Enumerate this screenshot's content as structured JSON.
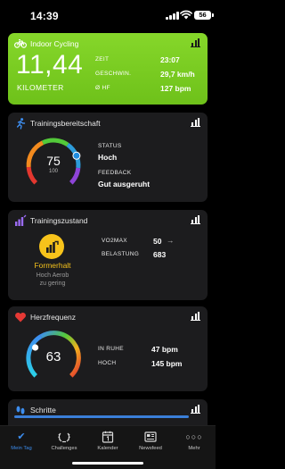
{
  "status_bar": {
    "time": "14:39",
    "battery": "56"
  },
  "cycling": {
    "title": "Indoor Cycling",
    "value": "11,44",
    "unit": "KILOMETER",
    "stats": [
      {
        "label": "ZEIT",
        "value": "23:07"
      },
      {
        "label": "GESCHWIN.",
        "value": "29,7 km/h"
      },
      {
        "label": "Ø HF",
        "value": "127 bpm"
      }
    ]
  },
  "readiness": {
    "title": "Trainingsbereitschaft",
    "score": "75",
    "max": "100",
    "level": 0.75,
    "status_label": "STATUS",
    "status_value": "Hoch",
    "feedback_label": "FEEDBACK",
    "feedback_value": "Gut ausgeruht"
  },
  "training_status": {
    "title": "Trainingszustand",
    "status": "Formerhalt",
    "sub_line1": "Hoch Aerob",
    "sub_line2": "zu gering",
    "vo2_label": "VO2MAX",
    "vo2_value": "50",
    "vo2_trend": "→",
    "load_label": "BELASTUNG",
    "load_value": "683"
  },
  "heart_rate": {
    "title": "Herzfrequenz",
    "current": "63",
    "rest_label": "IN RUHE",
    "rest_value": "47 bpm",
    "high_label": "HOCH",
    "high_value": "145 bpm"
  },
  "steps": {
    "title": "Schritte"
  },
  "tabs": [
    {
      "label": "Mein Tag",
      "icon": "checkmark-icon"
    },
    {
      "label": "Challenges",
      "icon": "laurel-icon"
    },
    {
      "label": "Kalender",
      "icon": "calendar-icon"
    },
    {
      "label": "Newsfeed",
      "icon": "newsfeed-icon"
    },
    {
      "label": "Mehr",
      "icon": "more-icon"
    }
  ],
  "colors": {
    "cycling_green": "#7ed321",
    "accent_blue": "#3d8ef0",
    "status_yellow": "#f7c31b",
    "heart_red": "#e53935"
  }
}
